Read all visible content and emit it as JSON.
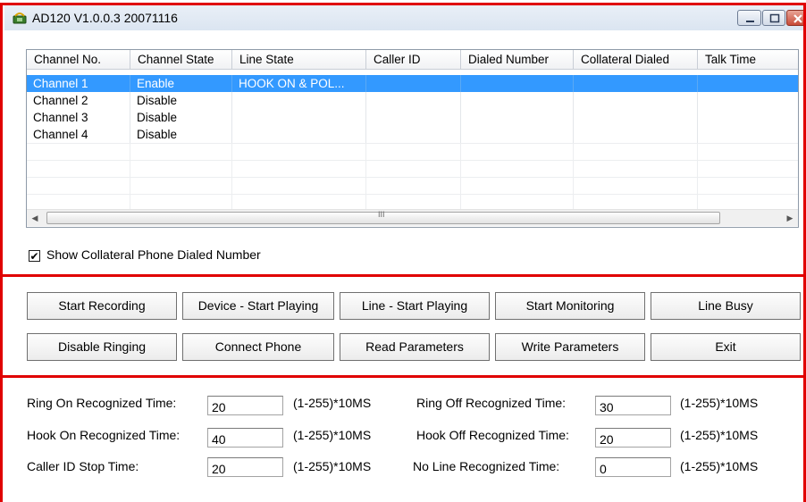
{
  "window": {
    "title": "AD120 V1.0.0.3 20071116",
    "icon": "phone-app-icon"
  },
  "listview": {
    "columns": [
      "Channel No.",
      "Channel State",
      "Line State",
      "Caller ID",
      "Dialed Number",
      "Collateral Dialed",
      "Talk Time"
    ],
    "rows": [
      {
        "channel": "Channel 1",
        "state": "Enable",
        "line_state": "HOOK ON & POL...",
        "caller_id": "",
        "dialed": "",
        "collateral": "",
        "talk_time": "",
        "selected": true
      },
      {
        "channel": "Channel 2",
        "state": "Disable",
        "line_state": "",
        "caller_id": "",
        "dialed": "",
        "collateral": "",
        "talk_time": "",
        "selected": false
      },
      {
        "channel": "Channel 3",
        "state": "Disable",
        "line_state": "",
        "caller_id": "",
        "dialed": "",
        "collateral": "",
        "talk_time": "",
        "selected": false
      },
      {
        "channel": "Channel 4",
        "state": "Disable",
        "line_state": "",
        "caller_id": "",
        "dialed": "",
        "collateral": "",
        "talk_time": "",
        "selected": false
      }
    ],
    "scroll_grip": "III"
  },
  "show_collateral": {
    "label": "Show Collateral Phone Dialed Number",
    "checked": true,
    "mark": "✔"
  },
  "buttons": {
    "row1": [
      "Start Recording",
      "Device - Start Playing",
      "Line - Start Playing",
      "Start Monitoring",
      "Line Busy"
    ],
    "row2": [
      "Disable Ringing",
      "Connect Phone",
      "Read Parameters",
      "Write Parameters",
      "Exit"
    ]
  },
  "params": {
    "left": [
      {
        "label": "Ring On Recognized Time:",
        "value": "20",
        "unit": "(1-255)*10MS"
      },
      {
        "label": "Hook On Recognized Time:",
        "value": "40",
        "unit": "(1-255)*10MS"
      },
      {
        "label": "Caller ID Stop Time:",
        "value": "20",
        "unit": "(1-255)*10MS"
      }
    ],
    "right": [
      {
        "label": "Ring Off Recognized Time:",
        "value": "30",
        "unit": "(1-255)*10MS"
      },
      {
        "label": "Hook Off Recognized Time:",
        "value": "20",
        "unit": "(1-255)*10MS"
      },
      {
        "label": "No Line Recognized Time:",
        "value": "0",
        "unit": "(1-255)*10MS"
      }
    ]
  },
  "colors": {
    "annotation": "#e00000",
    "selection": "#3399ff",
    "titlebar": "#dbe5f1",
    "close_button": "#d9534f"
  }
}
